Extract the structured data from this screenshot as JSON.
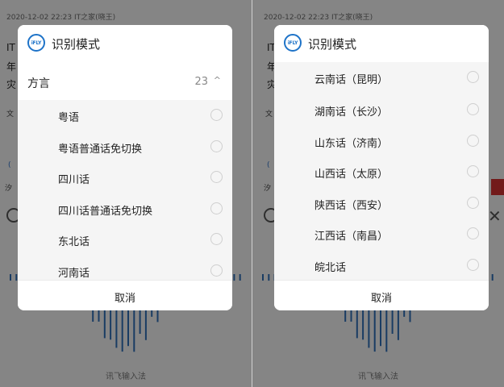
{
  "left_screen": {
    "background": {
      "meta": "2020-12-02 22:23  IT之家(晓王)",
      "lines": [
        "IT",
        "年",
        "灾"
      ],
      "small": [
        "文",
        "汐"
      ],
      "wave_label": "讯飞输入法"
    },
    "dialog": {
      "logo_text": "iFLY",
      "title": "识别模式",
      "group": {
        "label": "方言",
        "count": "23",
        "chevron": "^"
      },
      "items": [
        "粤语",
        "粤语普通话免切换",
        "四川话",
        "四川话普通话免切换",
        "东北话",
        "河南话"
      ],
      "cancel": "取消"
    }
  },
  "right_screen": {
    "background": {
      "meta": "2020-12-02 22:23  IT之家(晓王)",
      "lines": [
        "IT",
        "年",
        "灾"
      ],
      "small": [
        "文",
        "汐"
      ],
      "wave_label": "讯飞输入法"
    },
    "dialog": {
      "logo_text": "iFLY",
      "title": "识别模式",
      "items": [
        "云南话（昆明）",
        "湖南话（长沙）",
        "山东话（济南）",
        "山西话（太原）",
        "陕西话（西安）",
        "江西话（南昌）",
        "皖北话"
      ],
      "cancel": "取消"
    }
  },
  "colors": {
    "accent": "#1e73c8",
    "wave": "#2f6db5",
    "overlay": "rgba(0,0,0,0.45)"
  }
}
